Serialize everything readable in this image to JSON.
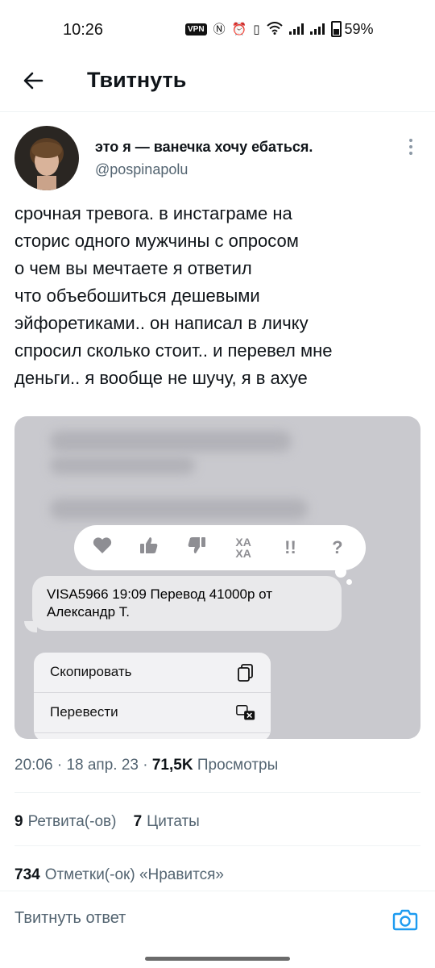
{
  "status_bar": {
    "time": "10:26",
    "vpn": "VPN",
    "battery": "59%"
  },
  "header": {
    "title": "Твитнуть",
    "back_icon": "arrow-left-icon"
  },
  "tweet": {
    "display_name": "это я — ванечка хочу ебаться.",
    "handle": "@pospinapolu",
    "text_lines": [
      "срочная тревога. в инстаграме на",
      "сторис одного мужчины с опросом",
      "о чем вы мечтаете я ответил",
      "что объебошиться дешевыми",
      "эйфоретиками.. он написал в личку",
      "спросил сколько стоит.. и перевел мне",
      "деньги.. я вообще не шучу, я в ахуе"
    ],
    "media": {
      "reactions": [
        "heart-icon",
        "thumbs-up-icon",
        "thumbs-down-icon",
        "haha-icon",
        "double-exclamation-icon",
        "question-icon"
      ],
      "reaction_labels": {
        "haha": "ХА ХА",
        "exclaim": "!!",
        "question": "?"
      },
      "sms_text_line1": "VISA5966 19:09 Перевод 41000р от",
      "sms_text_line2": "Александр Т.",
      "menu": [
        {
          "label": "Скопировать",
          "icon": "copy-icon"
        },
        {
          "label": "Перевести",
          "icon": "translate-icon"
        }
      ]
    },
    "time": "20:06",
    "date": "18 апр. 23",
    "views_count": "71,5K",
    "views_label": "Просмотры",
    "retweets_count": "9",
    "retweets_label": "Ретвита(-ов)",
    "quotes_count": "7",
    "quotes_label": "Цитаты",
    "likes_count": "734",
    "likes_label": "Отметки(-ок) «Нравится»"
  },
  "reply": {
    "placeholder": "Твитнуть ответ",
    "accent_color": "#1d9bf0"
  }
}
